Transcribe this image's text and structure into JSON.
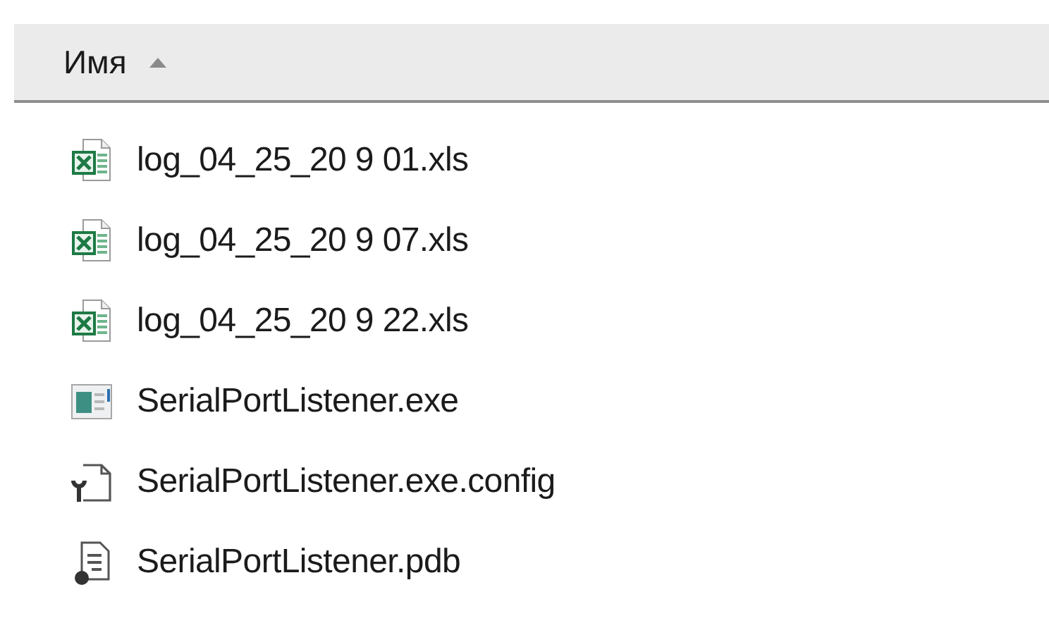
{
  "header": {
    "label": "Имя",
    "sorted_ascending": true
  },
  "files": [
    {
      "name": "log_04_25_20 9 01.xls",
      "kind": "excel"
    },
    {
      "name": "log_04_25_20 9 07.xls",
      "kind": "excel"
    },
    {
      "name": "log_04_25_20 9 22.xls",
      "kind": "excel"
    },
    {
      "name": "SerialPortListener.exe",
      "kind": "exe"
    },
    {
      "name": "SerialPortListener.exe.config",
      "kind": "config"
    },
    {
      "name": "SerialPortListener.pdb",
      "kind": "pdb"
    }
  ]
}
